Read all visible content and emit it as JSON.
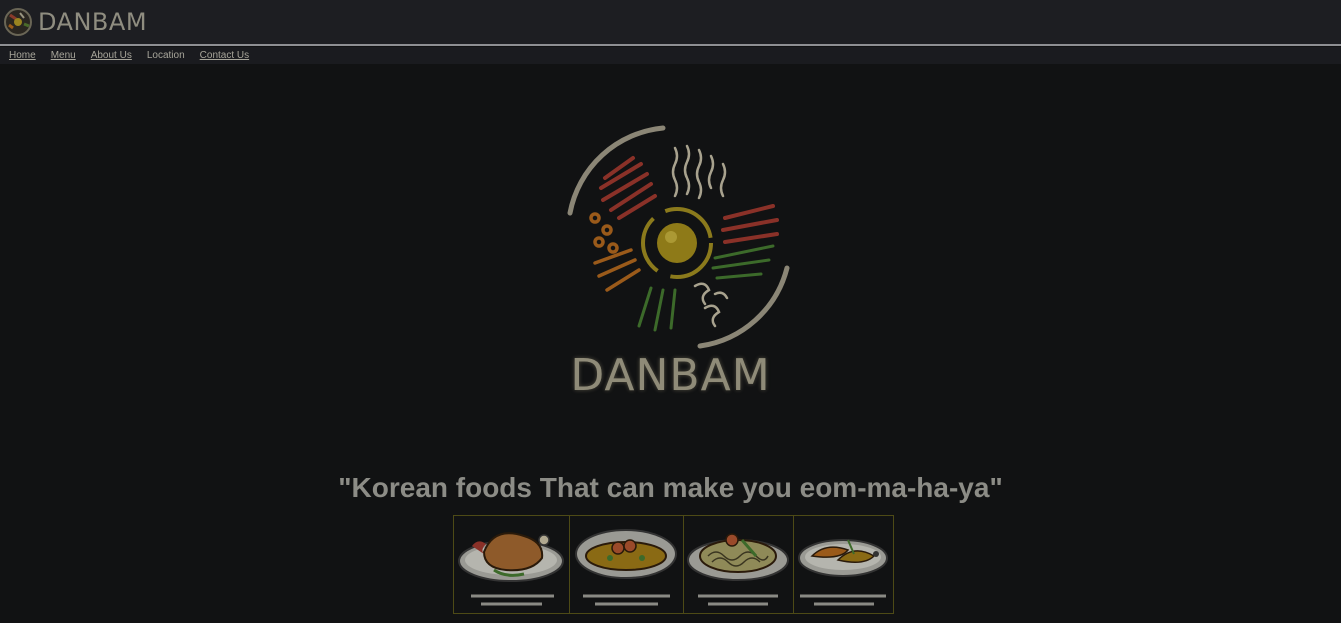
{
  "header": {
    "brand_name": "DANBAM",
    "logo_icon": "bibimbap-bowl-logo-icon"
  },
  "nav": {
    "items": [
      {
        "label": "Home",
        "underlined": true
      },
      {
        "label": "Menu",
        "underlined": true
      },
      {
        "label": "About Us",
        "underlined": true
      },
      {
        "label": "Location",
        "underlined": false
      },
      {
        "label": "Contact Us",
        "underlined": true
      }
    ]
  },
  "hero": {
    "logo_icon": "bibimbap-bowl-logo-icon",
    "wordmark": "DANBAM",
    "tagline": "\"Korean foods That can make you eom-ma-ha-ya\""
  },
  "foods": [
    {
      "icon": "roast-chicken-dish-icon"
    },
    {
      "icon": "curry-rice-dish-icon"
    },
    {
      "icon": "noodle-dish-icon"
    },
    {
      "icon": "fried-fish-dish-icon"
    }
  ],
  "colors": {
    "background": "#111213",
    "header_bg": "#1d1e22",
    "text_muted": "#8f8d80",
    "accent_border": "#4d4a16"
  }
}
